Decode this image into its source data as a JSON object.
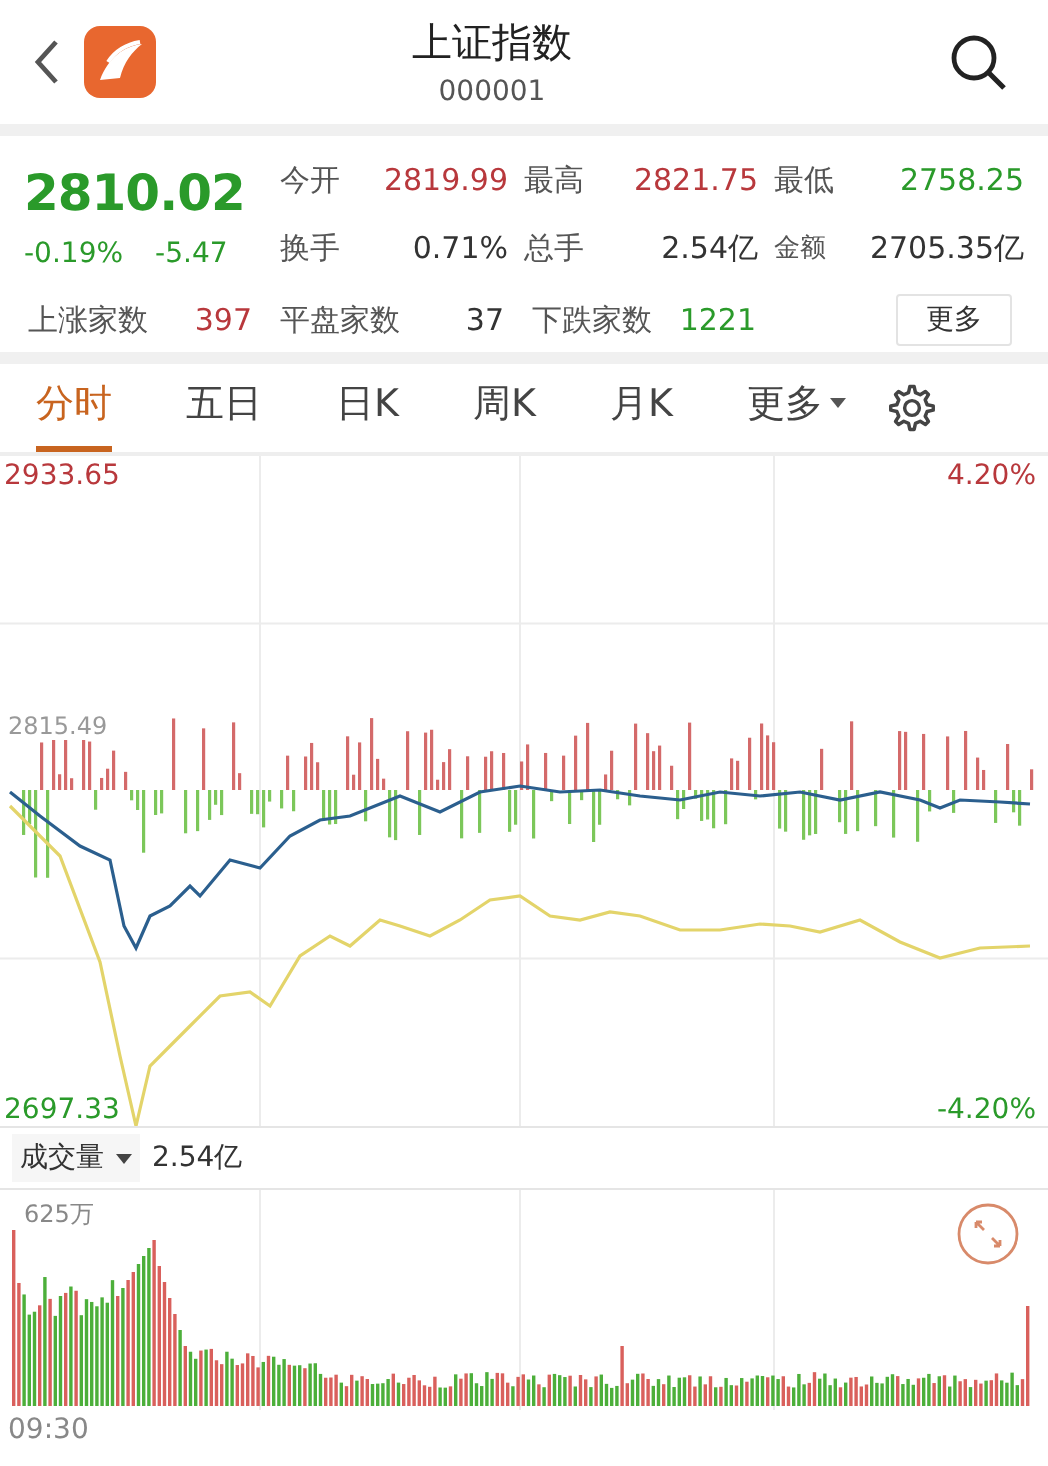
{
  "header": {
    "title": "上证指数",
    "code": "000001"
  },
  "quote": {
    "price": "2810.02",
    "color": "#2a9a2a",
    "change_pct": "-0.19%",
    "change": "-5.47",
    "stats": [
      {
        "label": "今开",
        "value": "2819.99",
        "color": "#b8383c"
      },
      {
        "label": "最高",
        "value": "2821.75",
        "color": "#b8383c"
      },
      {
        "label": "最低",
        "value": "2758.25",
        "color": "#2a9a2a"
      },
      {
        "label": "换手",
        "value": "0.71%",
        "color": "#333333"
      },
      {
        "label": "总手",
        "value": "2.54亿",
        "color": "#333333"
      },
      {
        "label": "金额",
        "value": "2705.35亿",
        "color": "#333333"
      }
    ],
    "breadth": [
      {
        "label": "上涨家数",
        "value": "397",
        "color": "#b8383c"
      },
      {
        "label": "平盘家数",
        "value": "37",
        "color": "#333333"
      },
      {
        "label": "下跌家数",
        "value": "1221",
        "color": "#2a9a2a"
      }
    ],
    "more_button": "更多"
  },
  "tabs": [
    {
      "label": "分时",
      "selected": true,
      "kind": "plain"
    },
    {
      "label": "五日",
      "selected": false,
      "kind": "plain"
    },
    {
      "label": "日K",
      "selected": false,
      "kind": "plain"
    },
    {
      "label": "周K",
      "selected": false,
      "kind": "plain"
    },
    {
      "label": "月K",
      "selected": false,
      "kind": "plain"
    },
    {
      "label": "更多",
      "selected": false,
      "kind": "dropdown"
    }
  ],
  "price_chart": {
    "high_label": "2933.65",
    "mid_label": "2815.49",
    "low_label": "2697.33",
    "percent_high": "4.20%",
    "percent_low": "-4.20%"
  },
  "volume": {
    "label": "成交量",
    "total": "2.54亿",
    "max_label": "625万",
    "time_start": "09:30"
  }
}
